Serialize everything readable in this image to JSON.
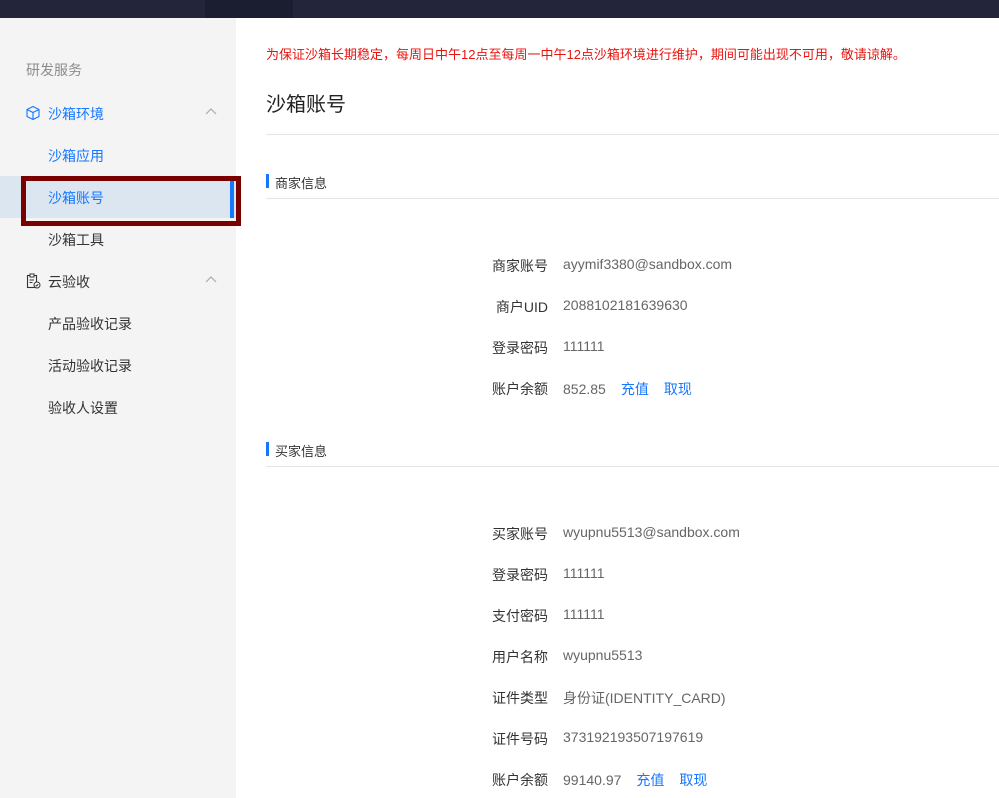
{
  "sidebar": {
    "section_title": "研发服务",
    "groups": [
      {
        "label": "沙箱环境",
        "items": [
          {
            "label": "沙箱应用"
          },
          {
            "label": "沙箱账号"
          },
          {
            "label": "沙箱工具"
          }
        ]
      },
      {
        "label": "云验收",
        "items": [
          {
            "label": "产品验收记录"
          },
          {
            "label": "活动验收记录"
          },
          {
            "label": "验收人设置"
          }
        ]
      }
    ]
  },
  "main": {
    "notice": "为保证沙箱长期稳定，每周日中午12点至每周一中午12点沙箱环境进行维护，期间可能出现不可用，敬请谅解。",
    "title": "沙箱账号",
    "merchant": {
      "heading": "商家信息",
      "fields": [
        {
          "label": "商家账号",
          "value": "ayymif3380@sandbox.com"
        },
        {
          "label": "商户UID",
          "value": "2088102181639630"
        },
        {
          "label": "登录密码",
          "value": "111111"
        },
        {
          "label": "账户余额",
          "value": "852.85",
          "recharge": "充值",
          "withdraw": "取现"
        }
      ]
    },
    "buyer": {
      "heading": "买家信息",
      "fields": [
        {
          "label": "买家账号",
          "value": "wyupnu5513@sandbox.com"
        },
        {
          "label": "登录密码",
          "value": "111111"
        },
        {
          "label": "支付密码",
          "value": "111111"
        },
        {
          "label": "用户名称",
          "value": "wyupnu5513"
        },
        {
          "label": "证件类型",
          "value": "身份证(IDENTITY_CARD)"
        },
        {
          "label": "证件号码",
          "value": "373192193507197619"
        },
        {
          "label": "账户余额",
          "value": "99140.97",
          "recharge": "充值",
          "withdraw": "取现"
        }
      ]
    }
  },
  "colors": {
    "accent": "#1677ff",
    "notice": "#e8140f",
    "topbar": "#23263b",
    "highlight": "#7a0000"
  }
}
